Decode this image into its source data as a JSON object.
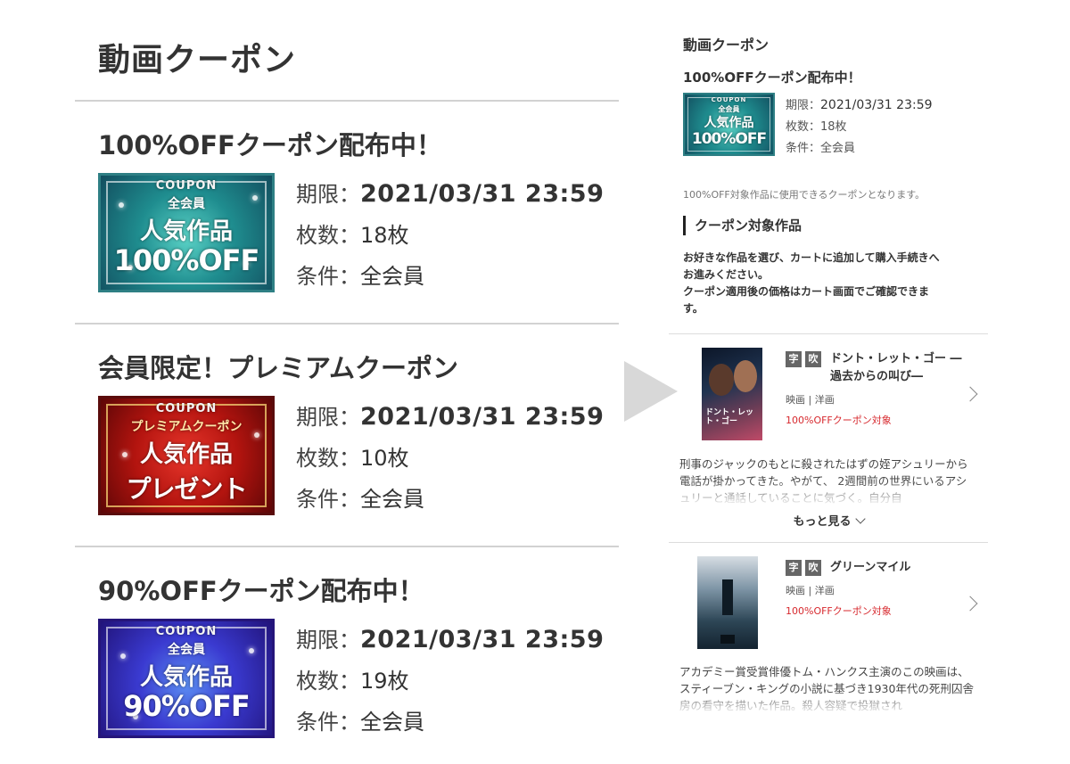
{
  "left": {
    "title": "動画クーポン",
    "coupons": [
      {
        "title": "100%OFFクーポン配布中！",
        "banner": {
          "coupon": "COUPON",
          "sub": "全会員",
          "main": "人気作品",
          "big": "100%OFF"
        },
        "expiry_label": "期限：",
        "expiry": "2021/03/31 23:59",
        "count_label": "枚数：",
        "count": "18枚",
        "cond_label": "条件：",
        "cond": "全会員"
      },
      {
        "title": "会員限定！プレミアムクーポン",
        "banner": {
          "coupon": "COUPON",
          "sub": "プレミアムクーポン",
          "main": "人気作品",
          "big": "プレゼント"
        },
        "expiry_label": "期限：",
        "expiry": "2021/03/31 23:59",
        "count_label": "枚数：",
        "count": "10枚",
        "cond_label": "条件：",
        "cond": "全会員"
      },
      {
        "title": "90%OFFクーポン配布中！",
        "banner": {
          "coupon": "COUPON",
          "sub": "全会員",
          "main": "人気作品",
          "big": "90%OFF"
        },
        "expiry_label": "期限：",
        "expiry": "2021/03/31 23:59",
        "count_label": "枚数：",
        "count": "19枚",
        "cond_label": "条件：",
        "cond": "全会員"
      }
    ]
  },
  "right": {
    "title": "動画クーポン",
    "coupon_title": "100%OFFクーポン配布中！",
    "banner": {
      "coupon": "COUPON",
      "sub": "全会員",
      "main": "人気作品",
      "big": "100%OFF"
    },
    "expiry_label": "期限：",
    "expiry": "2021/03/31 23:59",
    "count_label": "枚数：",
    "count": "18枚",
    "cond_label": "条件：",
    "cond": "全会員",
    "note": "100%OFF対象作品に使用できるクーポンとなります。",
    "section": "クーポン対象作品",
    "desc_line1": "お好きな作品を選び、カートに追加して購入手続きへ",
    "desc_line2": "お進みください。",
    "desc_line3": "クーポン適用後の価格はカート画面でご確認できま",
    "desc_line4": "す。",
    "titles": [
      {
        "tag1": "字",
        "tag2": "吹",
        "name": "ドント・レット・ゴー ―過去からの叫び―",
        "genre": "映画 | 洋画",
        "coupon": "100%OFFクーポン対象",
        "poster_text": "ドント・レット・ゴー",
        "synopsis": "刑事のジャックのもとに殺されたはずの姪アシュリーから電話が掛かってきた。やがて、 2週間前の世界にいるアシュリーと通話していることに気づく。自分自",
        "more": "もっと見る"
      },
      {
        "tag1": "字",
        "tag2": "吹",
        "name": "グリーンマイル",
        "genre": "映画 | 洋画",
        "coupon": "100%OFFクーポン対象",
        "synopsis": "アカデミー賞受賞俳優トム・ハンクス主演のこの映画は、スティーブン・キングの小説に基づき1930年代の死刑囚舎房の看守を描いた作品。殺人容疑で投獄され"
      }
    ]
  }
}
